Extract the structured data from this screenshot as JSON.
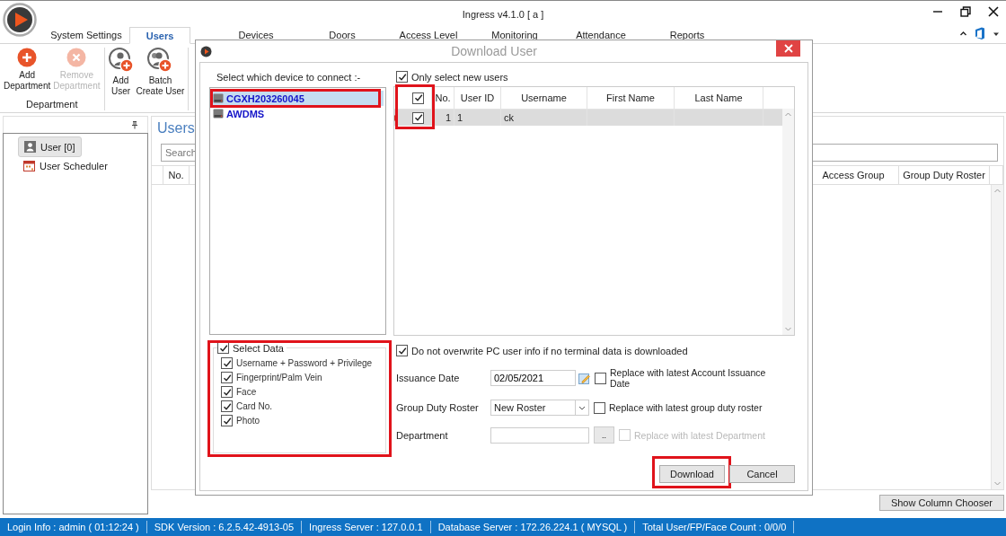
{
  "window": {
    "title": "Ingress v4.1.0 [ a ]"
  },
  "tabs": [
    {
      "label": "System Settings",
      "selected": false
    },
    {
      "label": "Users",
      "selected": true
    },
    {
      "label": "Devices",
      "selected": false
    },
    {
      "label": "Doors",
      "selected": false
    },
    {
      "label": "Access Level",
      "selected": false
    },
    {
      "label": "Monitoring",
      "selected": false
    },
    {
      "label": "Attendance",
      "selected": false
    },
    {
      "label": "Reports",
      "selected": false
    }
  ],
  "ribbon": {
    "groups": [
      {
        "label": "Department",
        "items": [
          {
            "label": "Add\nDepartment",
            "kind": "add",
            "disabled": false
          },
          {
            "label": "Remove\nDepartment",
            "kind": "remove",
            "disabled": true
          }
        ]
      },
      {
        "items": [
          {
            "label": "Add\nUser",
            "kind": "add-user",
            "disabled": false
          },
          {
            "label": "Batch\nCreate User",
            "kind": "batch-user",
            "disabled": false
          }
        ]
      }
    ]
  },
  "sidebar": {
    "items": [
      {
        "label": "User [0]",
        "kind": "user",
        "selected": true
      },
      {
        "label": "User Scheduler",
        "kind": "scheduler",
        "selected": false
      }
    ]
  },
  "users_panel": {
    "title": "Users",
    "search": {
      "placeholder": "Search"
    },
    "columns_left": [
      "No."
    ],
    "columns_right": [
      "Access Group",
      "Group Duty Roster"
    ],
    "column_chooser_button": "Show Column Chooser"
  },
  "dialog": {
    "title": "Download User",
    "device_label": "Select which device to connect :-",
    "devices": [
      {
        "name": "CGXH203260045",
        "selected": true,
        "highlighted": true
      },
      {
        "name": "AWDMS",
        "selected": false,
        "highlighted": false
      }
    ],
    "select_data": {
      "label": "Select Data",
      "checked": true,
      "highlighted": true,
      "options": [
        {
          "label": "Username + Password + Privilege",
          "checked": true
        },
        {
          "label": "Fingerprint/Palm Vein",
          "checked": true
        },
        {
          "label": "Face",
          "checked": true
        },
        {
          "label": "Card No.",
          "checked": true
        },
        {
          "label": "Photo",
          "checked": true
        }
      ]
    },
    "only_new": {
      "label": "Only select new users",
      "checked": true
    },
    "grid": {
      "columns": [
        "No.",
        "User ID",
        "Username",
        "First Name",
        "Last Name"
      ],
      "header_checked": true,
      "check_column_highlighted": true,
      "rows": [
        {
          "no": "1",
          "user_id": "1",
          "username": "ck",
          "checked": true,
          "selected": true
        }
      ]
    },
    "no_overwrite": {
      "label": "Do not overwrite PC user info if no terminal data is downloaded",
      "checked": true
    },
    "fields": [
      {
        "kind": "date",
        "label": "Issuance Date",
        "value": "02/05/2021",
        "replace": {
          "label": "Replace with latest Account Issuance Date",
          "checked": false,
          "disabled": false
        }
      },
      {
        "kind": "select",
        "label": "Group Duty Roster",
        "value": "New Roster",
        "replace": {
          "label": "Replace with latest group duty roster",
          "checked": false,
          "disabled": false
        }
      },
      {
        "kind": "picker",
        "label": "Department",
        "button": "..",
        "replace": {
          "label": "Replace with latest Department",
          "checked": false,
          "disabled": true
        }
      }
    ],
    "buttons": [
      {
        "label": "Download",
        "highlighted": true
      },
      {
        "label": "Cancel",
        "highlighted": false
      }
    ]
  },
  "status_bar": [
    "Login Info : admin ( 01:12:24 )",
    "SDK Version : 6.2.5.42-4913-05",
    "Ingress Server : 127.0.0.1",
    "Database Server : 172.26.224.1 ( MYSQL )",
    "Total User/FP/Face Count : 0/0/0"
  ]
}
